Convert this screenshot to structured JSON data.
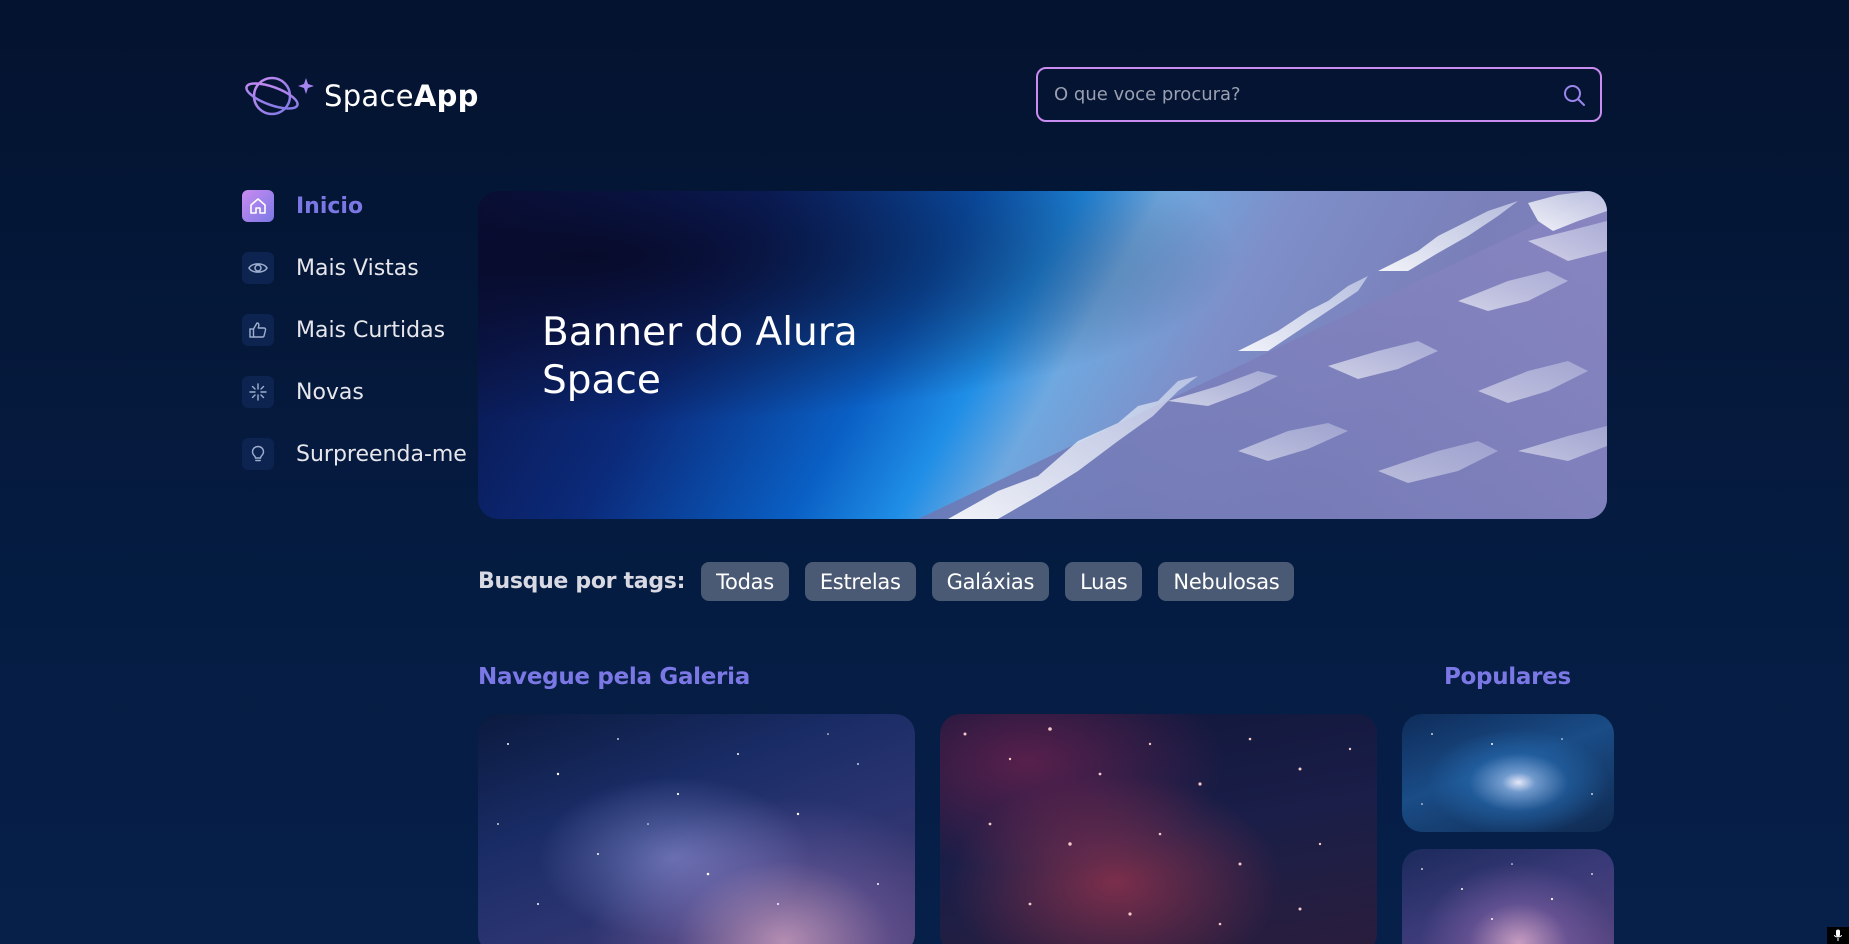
{
  "header": {
    "logo": {
      "text_light": "Space",
      "text_bold": "App",
      "icon": "planet-logo-icon"
    },
    "search": {
      "placeholder": "O que voce procura?",
      "value": "",
      "icon": "search-icon"
    }
  },
  "sidebar": {
    "items": [
      {
        "label": "Inicio",
        "icon": "home-icon",
        "active": true
      },
      {
        "label": "Mais Vistas",
        "icon": "eye-icon",
        "active": false
      },
      {
        "label": "Mais Curtidas",
        "icon": "thumbs-up-icon",
        "active": false
      },
      {
        "label": "Novas",
        "icon": "sparkle-icon",
        "active": false
      },
      {
        "label": "Surpreenda-me",
        "icon": "lightbulb-icon",
        "active": false
      }
    ]
  },
  "banner": {
    "title": "Banner do Alura Space"
  },
  "tags": {
    "label": "Busque por tags:",
    "items": [
      "Todas",
      "Estrelas",
      "Galáxias",
      "Luas",
      "Nebulosas"
    ]
  },
  "gallery": {
    "title": "Navegue pela Galeria"
  },
  "popular": {
    "title": "Populares"
  },
  "colors": {
    "background": "#04132f",
    "accent": "#7b78e5",
    "accent_light": "#c98cf1",
    "tag_background": "#4a5a74"
  }
}
